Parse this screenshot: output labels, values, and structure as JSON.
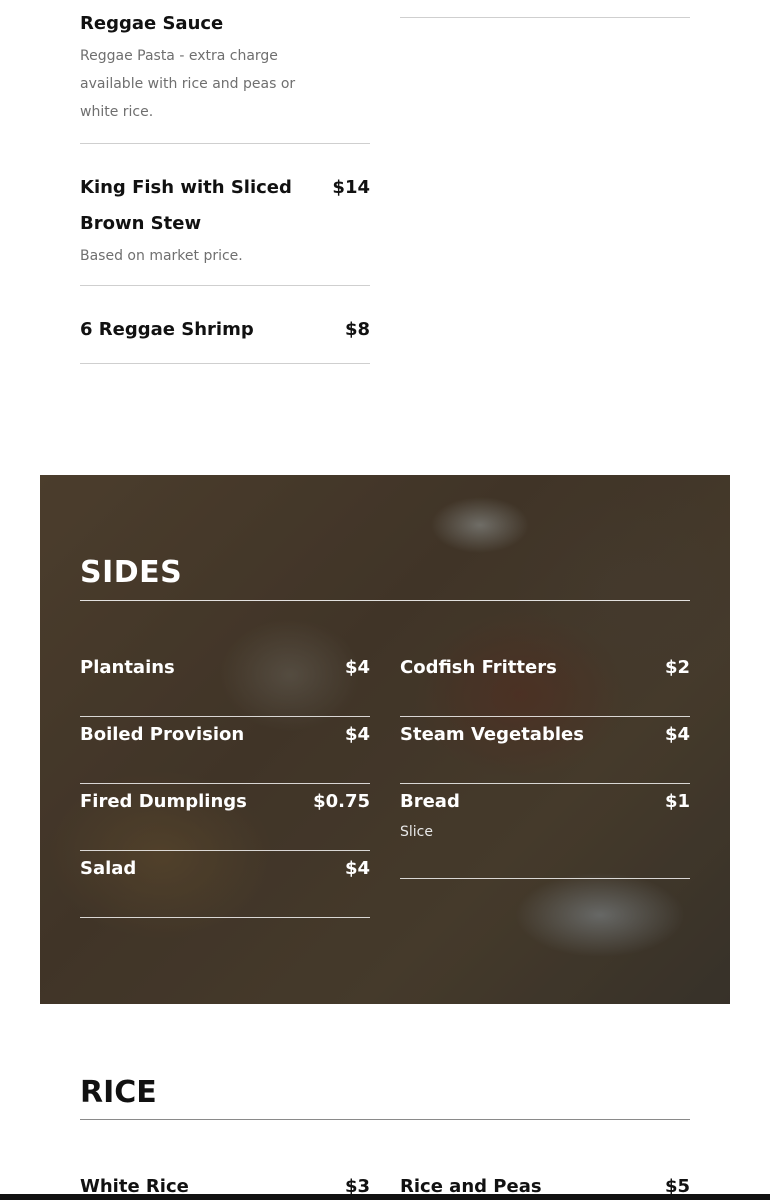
{
  "main_items": [
    {
      "name": "Reggae Sauce",
      "price": "",
      "description": "Reggae Pasta - extra charge available with rice and peas or white rice."
    },
    {
      "name": "King Fish with Sliced Brown Stew",
      "price": "$14",
      "description": "Based on market price."
    },
    {
      "name": "6 Reggae Shrimp",
      "price": "$8",
      "description": ""
    }
  ],
  "sides": {
    "title": "SIDES",
    "left": [
      {
        "name": "Plantains",
        "price": "$4"
      },
      {
        "name": "Boiled Provision",
        "price": "$4"
      },
      {
        "name": "Fired Dumplings",
        "price": "$0.75"
      },
      {
        "name": "Salad",
        "price": "$4"
      }
    ],
    "right": [
      {
        "name": "Codfish Fritters",
        "price": "$2"
      },
      {
        "name": "Steam Vegetables",
        "price": "$4"
      },
      {
        "name": "Bread",
        "price": "$1",
        "description": "Slice"
      }
    ]
  },
  "rice": {
    "title": "RICE",
    "items": [
      {
        "name": "White Rice",
        "price": "$3"
      },
      {
        "name": "Rice and Peas",
        "price": "$5"
      }
    ]
  },
  "colors": {
    "panel_text": "#ffffff",
    "body_text": "#111111",
    "muted_text": "#6f6f6f"
  }
}
